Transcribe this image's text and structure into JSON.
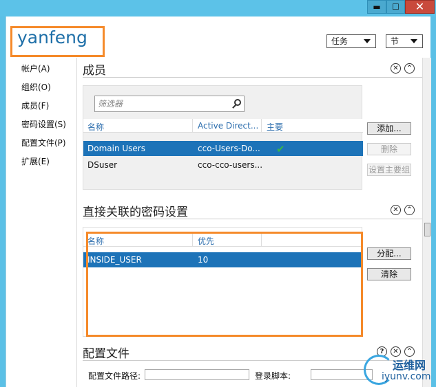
{
  "window": {
    "min": "▬",
    "max": "☐",
    "close": "✕"
  },
  "header": {
    "user_name": "yanfeng",
    "task_label": "任务",
    "section_label": "节"
  },
  "nav": {
    "items": [
      {
        "label": "帐户(A)"
      },
      {
        "label": "组织(O)"
      },
      {
        "label": "成员(F)"
      },
      {
        "label": "密码设置(S)"
      },
      {
        "label": "配置文件(P)"
      },
      {
        "label": "扩展(E)"
      }
    ]
  },
  "members": {
    "title": "成员",
    "filter_placeholder": "筛选器",
    "columns": {
      "name": "名称",
      "ad": "Active Direct...",
      "primary": "主要"
    },
    "rows": [
      {
        "name": "Domain Users",
        "ad": "cco-Users-Do...",
        "primary": "✔"
      },
      {
        "name": "DSuser",
        "ad": "cco-cco-users...",
        "primary": ""
      }
    ],
    "buttons": {
      "add": "添加...",
      "remove": "删除",
      "set_primary": "设置主要组"
    }
  },
  "password": {
    "title": "直接关联的密码设置",
    "columns": {
      "name": "名称",
      "priority": "优先"
    },
    "rows": [
      {
        "name": "INSIDE_USER",
        "priority": "10"
      }
    ],
    "buttons": {
      "assign": "分配...",
      "clear": "清除"
    }
  },
  "profile": {
    "title": "配置文件",
    "path_label": "配置文件路径:",
    "script_label": "登录脚本:"
  },
  "icons": {
    "close": "✕",
    "collapse": "⌃",
    "help": "?"
  },
  "watermark": {
    "line1": "运维网",
    "line2": "iyunv.com"
  },
  "colors": {
    "accent": "#1d73b8",
    "highlight": "#f58a2a",
    "title_bar": "#5cc2e8"
  }
}
